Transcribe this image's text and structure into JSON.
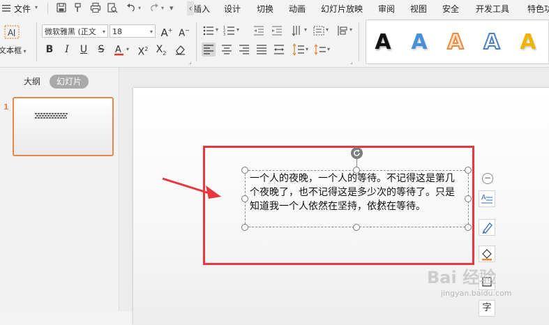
{
  "menubar": {
    "file_label": "文件",
    "tabs": [
      "插入",
      "设计",
      "切换",
      "动画",
      "幻灯片放映",
      "审阅",
      "视图",
      "安全",
      "开发工具",
      "特色功能"
    ],
    "collapse_glyph": "‹",
    "insert_partial": "插入"
  },
  "ribbon": {
    "textbox_label": "文本框",
    "font_name": "微软雅黑 (正文",
    "font_size": "18",
    "style_letter": "A"
  },
  "left_panel": {
    "tabs": [
      "大纲",
      "幻灯片"
    ],
    "active_tab": "幻灯片",
    "slide_number": "1"
  },
  "slide": {
    "body_text": "一个人的夜晚，一个人的等待。不记得这是第几个夜晚了，也不记得这是多少次的等待了。只是知道我一个人依然在坚持，依然在等待。"
  },
  "side_tools": {
    "collapse_glyph": "−",
    "text_glyph": "字"
  },
  "watermark": {
    "text": "Bai 经验",
    "url": "jingyan.baidu.com"
  },
  "colors": {
    "accent_red": "#e8373d",
    "thumb_border": "#e5884a",
    "style_blue": "#4a90d9",
    "style_orange": "#f08a3a",
    "style_gold": "#f0b400"
  }
}
